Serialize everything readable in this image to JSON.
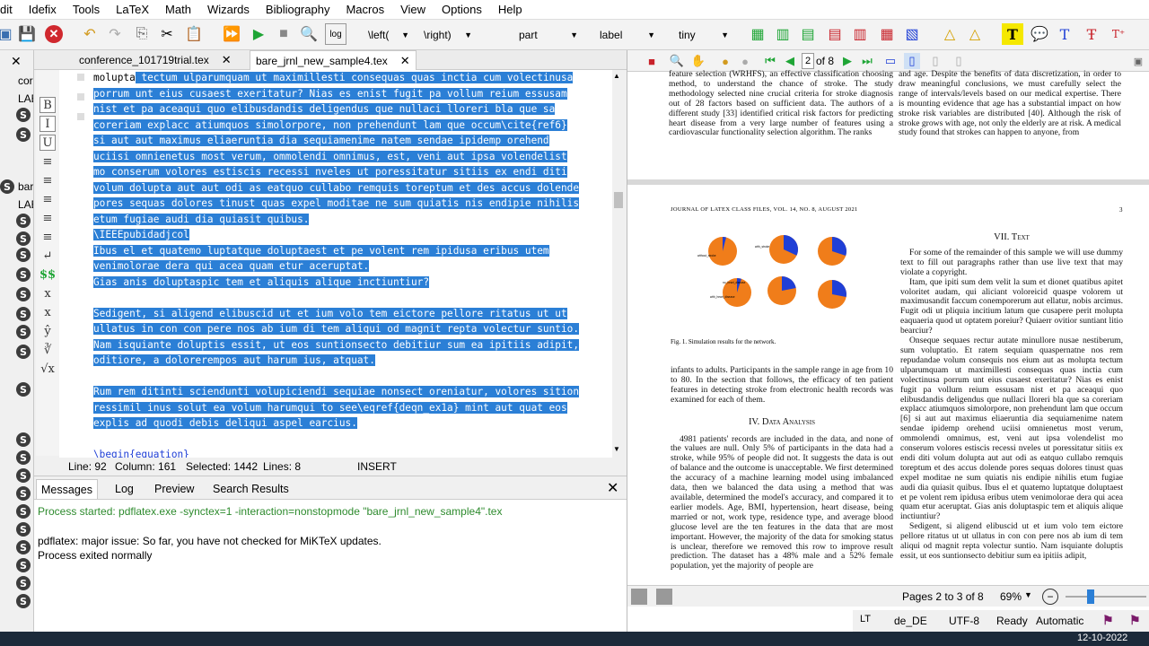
{
  "menu": [
    "dit",
    "Idefix",
    "Tools",
    "LaTeX",
    "Math",
    "Wizards",
    "Bibliography",
    "Macros",
    "View",
    "Options",
    "Help"
  ],
  "toolbar": {
    "left_delim": "\\left(",
    "right_delim": "\\right)",
    "part": "part",
    "label": "label",
    "size": "tiny"
  },
  "left_strip": {
    "items": [
      {
        "type": "close",
        "label": "✕"
      },
      {
        "type": "text",
        "label": "cor"
      },
      {
        "type": "text",
        "label": "LAB"
      },
      {
        "type": "s",
        "label": "S"
      },
      {
        "type": "s",
        "label": "S"
      },
      {
        "type": "s",
        "label": "S"
      },
      {
        "type": "text",
        "label": "bar"
      },
      {
        "type": "text",
        "label": "LAB"
      },
      {
        "type": "s",
        "label": "S"
      },
      {
        "type": "s",
        "label": "S"
      },
      {
        "type": "s",
        "label": "S"
      },
      {
        "type": "s",
        "label": "S"
      },
      {
        "type": "s",
        "label": "S"
      },
      {
        "type": "s",
        "label": "S"
      },
      {
        "type": "s",
        "label": "S"
      },
      {
        "type": "s",
        "label": "S"
      },
      {
        "type": "s",
        "label": "S"
      }
    ],
    "lower": [
      "S",
      "S",
      "S",
      "S",
      "S",
      "S",
      "S",
      "S",
      "S",
      "S"
    ]
  },
  "symbols": [
    "B",
    "I",
    "U",
    "≡",
    "≡",
    "≡",
    "≡",
    "≡",
    "↵",
    "$$",
    "x",
    "x",
    "ŷ",
    "∛",
    "√x"
  ],
  "tabs": [
    {
      "label": "conference_101719trial.tex",
      "active": false
    },
    {
      "label": "bare_jrnl_new_sample4.tex",
      "active": true
    }
  ],
  "code_lines": [
    {
      "pre": "molupta",
      "sel": " tectum ulparumquam ut maximillesti consequas quas inctia cum volectinusa"
    },
    {
      "pre": "",
      "sel": "porrum unt eius cusaest exeritatur? Nias es enist fugit pa vollum reium essusam"
    },
    {
      "pre": "",
      "sel": "nist et pa aceaqui quo elibusdandis deligendus que nullaci lloreri bla que sa"
    },
    {
      "pre": "",
      "sel": "coreriam explacc atiumquos simolorpore, non prehendunt lam que occum\\cite{ref6}"
    },
    {
      "pre": "",
      "sel": "si aut aut maximus eliaeruntia dia sequiamenime natem sendae ipidemp orehend"
    },
    {
      "pre": "",
      "sel": "uciisi omnienetus most verum, ommolendi omnimus, est, veni aut ipsa volendelist"
    },
    {
      "pre": "",
      "sel": "mo conserum volores estiscis recessi nveles ut poressitatur sitiis ex endi diti"
    },
    {
      "pre": "",
      "sel": "volum dolupta aut aut odi as eatquo cullabo remquis toreptum et des accus dolende"
    },
    {
      "pre": "",
      "sel": "pores sequas dolores tinust quas expel moditae ne sum quiatis nis endipie nihilis"
    },
    {
      "pre": "",
      "sel": "etum fugiae audi dia quiasit quibus."
    },
    {
      "pre": "",
      "sel": "\\IEEEpubidadjcol"
    },
    {
      "pre": "",
      "sel": "Ibus el et quatemo luptatque doluptaest et pe volent rem ipidusa eribus utem"
    },
    {
      "pre": "",
      "sel": "venimolorae dera qui acea quam etur aceruptat."
    },
    {
      "pre": "",
      "sel": "Gias anis doluptaspic tem et aliquis alique inctiuntiur?"
    },
    {
      "pre": "",
      "sel": ""
    },
    {
      "pre": "",
      "sel": "Sedigent, si aligend elibuscid ut et ium volo tem eictore pellore ritatus ut ut"
    },
    {
      "pre": "",
      "sel": "ullatus in con con pere nos ab ium di tem aliqui od magnit repta volectur suntio."
    },
    {
      "pre": "",
      "sel": "Nam isquiante doluptis essit, ut eos suntionsecto debitiur sum ea ipitiis adipit,"
    },
    {
      "pre": "",
      "sel": "oditiore, a dolorerempos aut harum ius, atquat."
    },
    {
      "pre": "",
      "sel": ""
    },
    {
      "pre": "",
      "sel": "Rum rem ditinti sciendunti volupiciendi sequiae nonsect oreniatur, volores sition"
    },
    {
      "pre": "",
      "sel": "ressimil inus solut ea volum harumqui to see\\eqref{deqn_ex1a} mint aut quat eos"
    },
    {
      "pre": "",
      "sel": "explis ad quodi debis deliqui aspel earcius."
    },
    {
      "pre": "",
      "sel": ""
    },
    {
      "pre": "\\begin{equation}",
      "sel": ""
    }
  ],
  "status": {
    "line": "Line: 92",
    "column": "Column: 161",
    "selected": "Selected: 1442",
    "lines": "Lines: 8",
    "mode": "INSERT"
  },
  "messages": {
    "tabs": [
      "Messages",
      "Log",
      "Preview",
      "Search Results"
    ],
    "lines": [
      {
        "text": "Process started: pdflatex.exe -synctex=1 -interaction=nonstopmode \"bare_jrnl_new_sample4\".tex",
        "color": "#2e8b2e"
      },
      {
        "text": "pdflatex: major issue: So far, you have not checked for MiKTeX updates.",
        "color": "#000000"
      },
      {
        "text": "Process exited normally",
        "color": "#000000"
      }
    ]
  },
  "pdf": {
    "page_input": "2",
    "page_of": "of 8",
    "page1_left": "feature selection (WRHFS), an effective classification choosing method, to understand the chance of stroke. The study methodology selected nine crucial criteria for stroke diagnosis out of 28 factors based on sufficient data. The authors of a different study [33] identified critical risk factors for predicting heart disease from a very large number of features using a cardiovascular functionality selection algorithm. The ranks",
    "page1_right": "and age. Despite the benefits of data discretization, in order to draw meaningful conclusions, we must carefully select the range of intervals/levels based on our medical expertise. There is mounting evidence that age has a substantial impact on how stroke risk variables are distributed [40]. Although the risk of stroke grows with age, not only the elderly are at risk. A medical study found that strokes can happen to anyone, from",
    "header": "JOURNAL OF LATEX CLASS FILES, VOL. 14, NO. 8, AUGUST 2021",
    "page_number": "3",
    "figure_caption": "Fig. 1.  Simulation results for the network.",
    "pie_labels": [
      "without_stroke",
      "with_stroke",
      "",
      "",
      "with_heart_disease",
      "",
      "no_heart_disease",
      "",
      ""
    ],
    "left_para1": "infants to adults. Participants in the sample range in age from 10 to 80. In the section that follows, the efficacy of ten patient features in detecting stroke from electronic health records was examined for each of them.",
    "section4_title": "IV. Data Analysis",
    "left_para2": "4981 patients' records are included in the data, and none of the values are null. Only 5% of participants in the data had a stroke, while 95% of people did not. It suggests the data is out of balance and the outcome is unacceptable. We first determined the accuracy of a machine learning model using imbalanced data, then we balanced the data using a method that was available, determined the model's accuracy, and compared it to earlier models. Age, BMI, hypertension, heart disease, being married or not, work type, residence type, and average blood glucose level are the ten features in the data that are most important. However, the majority of the data for smoking status is unclear, therefore we removed this row to improve result prediction. The dataset has a 48% male and a 52% female population, yet the majority of people are",
    "section7_title": "VII. Text",
    "right_para1": "For some of the remainder of this sample we will use dummy text to fill out paragraphs rather than use live text that may violate a copyright.",
    "right_para2": "Itam, que ipiti sum dem velit la sum et dionet quatibus apitet voloritet audam, qui aliciant voloreicid quaspe volorem ut maximusandit faccum conemporerum aut ellatur, nobis arcimus. Fugit odi ut pliquia incitium latum que cusapere perit molupta eaquaeria quod ut optatem poreiur? Quiaerr ovitior suntiant litio bearciur?",
    "right_para3": "Onseque sequaes rectur autate minullore nusae nestiberum, sum voluptatio. Et ratem sequiam quaspernatne nos rem repudandae volum consequis nos eium aut as molupta tectum ulparumquam ut maximillesti consequas quas inctia cum volectinusa porrum unt eius cusaest exeritatur? Nias es enist fugit pa vollum reium essusam nist et pa aceaqui quo elibusdandis deligendus que nullaci lloreri bla que sa coreriam explacc atiumquos simolorpore, non prehendunt lam que occum [6] si aut aut maximus eliaeruntia dia sequiamenime natem sendae ipidemp orehend uciisi omnienetus most verum, ommolendi omnimus, est, veni aut ipsa volendelist mo conserum volores estiscis recessi nveles ut poressitatur sitiis ex endi diti volum dolupta aut aut odi as eatquo cullabo remquis toreptum et des accus dolende pores sequas dolores tinust quas expel moditae ne sum quiatis nis endipie nihilis etum fugiae audi dia quiasit quibus. Ibus el et quatemo luptatque doluptaest et pe volent rem ipidusa eribus utem venimolorae dera qui acea quam etur aceruptat. Gias anis doluptaspic tem et aliquis alique inctiuntiur?",
    "right_para4": "Sedigent, si aligend elibuscid ut et ium volo tem eictore pellore ritatus ut ut ullatus in con con pere nos ab ium di tem aliqui od magnit repta volectur suntio. Nam isquiante doluptis essit, ut eos suntionsecto debitiur sum ea ipitiis adipit,",
    "pages_label": "Pages 2 to 3 of 8",
    "zoom": "69%"
  },
  "bottom": {
    "lang": "de_DE",
    "encoding": "UTF-8",
    "state": "Ready",
    "mode": "Automatic",
    "date": "12-10-2022"
  },
  "colors": {
    "selection": "#2b7fd6",
    "pie_orange": "#f07d1a",
    "pie_blue": "#1f3fd6",
    "process_green": "#2e8b2e"
  }
}
